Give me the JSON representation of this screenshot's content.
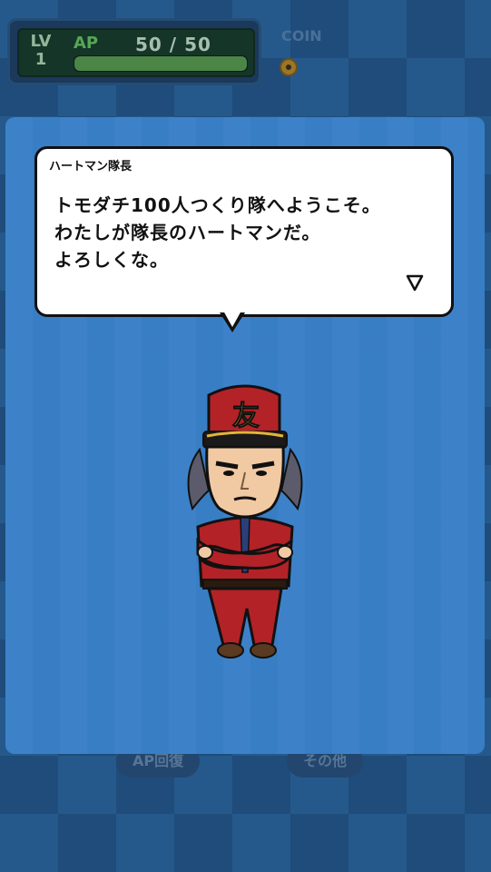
{
  "status": {
    "lv_label": "LV",
    "lv_value": "1",
    "ap_label": "AP",
    "ap_value": "50 / 50",
    "ap_fill": 1.0,
    "coin_label": "COIN"
  },
  "dialog": {
    "speaker": "ハートマン隊長",
    "lines": [
      "トモダチ100人つくり隊へようこそ。",
      "わたしが隊長のハートマンだ。",
      "よろしくな。"
    ],
    "next_icon": "triangle-down-icon"
  },
  "bottom": {
    "ap_recover": "AP回復",
    "other": "その他"
  },
  "colors": {
    "panel": "#3980c8",
    "ap_green": "#6ed15a",
    "uniform": "#b32227"
  }
}
